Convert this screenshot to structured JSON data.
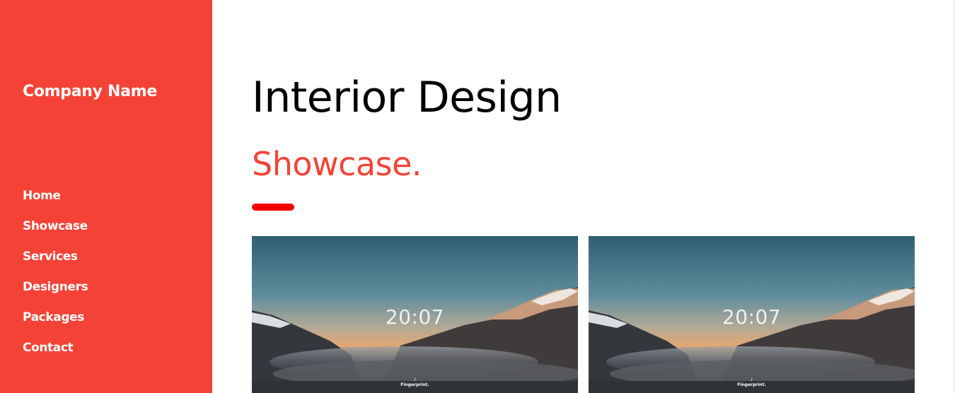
{
  "sidebar": {
    "brand": "Company Name",
    "nav": [
      {
        "label": "Home"
      },
      {
        "label": "Showcase"
      },
      {
        "label": "Services"
      },
      {
        "label": "Designers"
      },
      {
        "label": "Packages"
      },
      {
        "label": "Contact"
      }
    ]
  },
  "main": {
    "title": "Interior Design",
    "section_title": "Showcase."
  },
  "gallery": [
    {
      "time": "20:07",
      "brand": "Fingerprint.",
      "note_icon": "music-note-icon"
    },
    {
      "time": "20:07",
      "brand": "Fingerprint.",
      "note_icon": "music-note-icon"
    }
  ],
  "colors": {
    "sidebar_bg": "#f44336",
    "accent_text": "#f44336",
    "accent_bar": "#f40000",
    "title_text": "#000000"
  }
}
